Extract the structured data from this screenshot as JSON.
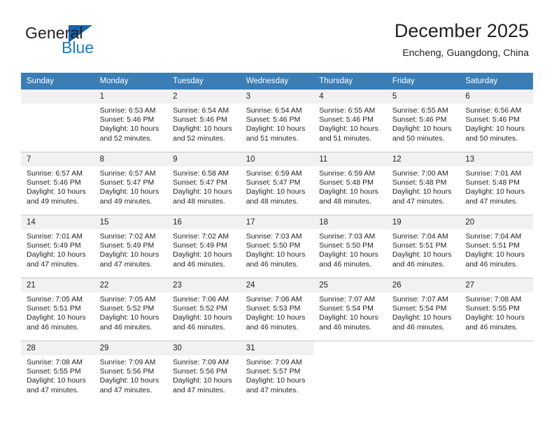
{
  "logo": {
    "word_one": "General",
    "word_two": "Blue",
    "triangle_color": "#1761a8",
    "blue_color": "#1f7ac0"
  },
  "header": {
    "title": "December 2025",
    "subtitle": "Encheng, Guangdong, China"
  },
  "theme": {
    "header_row_bg": "#3b7db5",
    "daynum_bg": "#f1f1f1",
    "grid_line": "#c8c8c8",
    "text": "#231f20"
  },
  "weekday_headers": [
    "Sunday",
    "Monday",
    "Tuesday",
    "Wednesday",
    "Thursday",
    "Friday",
    "Saturday"
  ],
  "weeks": [
    [
      {
        "day": "",
        "sunrise": "",
        "sunset": "",
        "daylight_line1": "",
        "daylight_line2": ""
      },
      {
        "day": "1",
        "sunrise": "Sunrise: 6:53 AM",
        "sunset": "Sunset: 5:46 PM",
        "daylight_line1": "Daylight: 10 hours",
        "daylight_line2": "and 52 minutes."
      },
      {
        "day": "2",
        "sunrise": "Sunrise: 6:54 AM",
        "sunset": "Sunset: 5:46 PM",
        "daylight_line1": "Daylight: 10 hours",
        "daylight_line2": "and 52 minutes."
      },
      {
        "day": "3",
        "sunrise": "Sunrise: 6:54 AM",
        "sunset": "Sunset: 5:46 PM",
        "daylight_line1": "Daylight: 10 hours",
        "daylight_line2": "and 51 minutes."
      },
      {
        "day": "4",
        "sunrise": "Sunrise: 6:55 AM",
        "sunset": "Sunset: 5:46 PM",
        "daylight_line1": "Daylight: 10 hours",
        "daylight_line2": "and 51 minutes."
      },
      {
        "day": "5",
        "sunrise": "Sunrise: 6:55 AM",
        "sunset": "Sunset: 5:46 PM",
        "daylight_line1": "Daylight: 10 hours",
        "daylight_line2": "and 50 minutes."
      },
      {
        "day": "6",
        "sunrise": "Sunrise: 6:56 AM",
        "sunset": "Sunset: 5:46 PM",
        "daylight_line1": "Daylight: 10 hours",
        "daylight_line2": "and 50 minutes."
      }
    ],
    [
      {
        "day": "7",
        "sunrise": "Sunrise: 6:57 AM",
        "sunset": "Sunset: 5:46 PM",
        "daylight_line1": "Daylight: 10 hours",
        "daylight_line2": "and 49 minutes."
      },
      {
        "day": "8",
        "sunrise": "Sunrise: 6:57 AM",
        "sunset": "Sunset: 5:47 PM",
        "daylight_line1": "Daylight: 10 hours",
        "daylight_line2": "and 49 minutes."
      },
      {
        "day": "9",
        "sunrise": "Sunrise: 6:58 AM",
        "sunset": "Sunset: 5:47 PM",
        "daylight_line1": "Daylight: 10 hours",
        "daylight_line2": "and 48 minutes."
      },
      {
        "day": "10",
        "sunrise": "Sunrise: 6:59 AM",
        "sunset": "Sunset: 5:47 PM",
        "daylight_line1": "Daylight: 10 hours",
        "daylight_line2": "and 48 minutes."
      },
      {
        "day": "11",
        "sunrise": "Sunrise: 6:59 AM",
        "sunset": "Sunset: 5:48 PM",
        "daylight_line1": "Daylight: 10 hours",
        "daylight_line2": "and 48 minutes."
      },
      {
        "day": "12",
        "sunrise": "Sunrise: 7:00 AM",
        "sunset": "Sunset: 5:48 PM",
        "daylight_line1": "Daylight: 10 hours",
        "daylight_line2": "and 47 minutes."
      },
      {
        "day": "13",
        "sunrise": "Sunrise: 7:01 AM",
        "sunset": "Sunset: 5:48 PM",
        "daylight_line1": "Daylight: 10 hours",
        "daylight_line2": "and 47 minutes."
      }
    ],
    [
      {
        "day": "14",
        "sunrise": "Sunrise: 7:01 AM",
        "sunset": "Sunset: 5:49 PM",
        "daylight_line1": "Daylight: 10 hours",
        "daylight_line2": "and 47 minutes."
      },
      {
        "day": "15",
        "sunrise": "Sunrise: 7:02 AM",
        "sunset": "Sunset: 5:49 PM",
        "daylight_line1": "Daylight: 10 hours",
        "daylight_line2": "and 47 minutes."
      },
      {
        "day": "16",
        "sunrise": "Sunrise: 7:02 AM",
        "sunset": "Sunset: 5:49 PM",
        "daylight_line1": "Daylight: 10 hours",
        "daylight_line2": "and 46 minutes."
      },
      {
        "day": "17",
        "sunrise": "Sunrise: 7:03 AM",
        "sunset": "Sunset: 5:50 PM",
        "daylight_line1": "Daylight: 10 hours",
        "daylight_line2": "and 46 minutes."
      },
      {
        "day": "18",
        "sunrise": "Sunrise: 7:03 AM",
        "sunset": "Sunset: 5:50 PM",
        "daylight_line1": "Daylight: 10 hours",
        "daylight_line2": "and 46 minutes."
      },
      {
        "day": "19",
        "sunrise": "Sunrise: 7:04 AM",
        "sunset": "Sunset: 5:51 PM",
        "daylight_line1": "Daylight: 10 hours",
        "daylight_line2": "and 46 minutes."
      },
      {
        "day": "20",
        "sunrise": "Sunrise: 7:04 AM",
        "sunset": "Sunset: 5:51 PM",
        "daylight_line1": "Daylight: 10 hours",
        "daylight_line2": "and 46 minutes."
      }
    ],
    [
      {
        "day": "21",
        "sunrise": "Sunrise: 7:05 AM",
        "sunset": "Sunset: 5:51 PM",
        "daylight_line1": "Daylight: 10 hours",
        "daylight_line2": "and 46 minutes."
      },
      {
        "day": "22",
        "sunrise": "Sunrise: 7:05 AM",
        "sunset": "Sunset: 5:52 PM",
        "daylight_line1": "Daylight: 10 hours",
        "daylight_line2": "and 46 minutes."
      },
      {
        "day": "23",
        "sunrise": "Sunrise: 7:06 AM",
        "sunset": "Sunset: 5:52 PM",
        "daylight_line1": "Daylight: 10 hours",
        "daylight_line2": "and 46 minutes."
      },
      {
        "day": "24",
        "sunrise": "Sunrise: 7:06 AM",
        "sunset": "Sunset: 5:53 PM",
        "daylight_line1": "Daylight: 10 hours",
        "daylight_line2": "and 46 minutes."
      },
      {
        "day": "25",
        "sunrise": "Sunrise: 7:07 AM",
        "sunset": "Sunset: 5:54 PM",
        "daylight_line1": "Daylight: 10 hours",
        "daylight_line2": "and 46 minutes."
      },
      {
        "day": "26",
        "sunrise": "Sunrise: 7:07 AM",
        "sunset": "Sunset: 5:54 PM",
        "daylight_line1": "Daylight: 10 hours",
        "daylight_line2": "and 46 minutes."
      },
      {
        "day": "27",
        "sunrise": "Sunrise: 7:08 AM",
        "sunset": "Sunset: 5:55 PM",
        "daylight_line1": "Daylight: 10 hours",
        "daylight_line2": "and 46 minutes."
      }
    ],
    [
      {
        "day": "28",
        "sunrise": "Sunrise: 7:08 AM",
        "sunset": "Sunset: 5:55 PM",
        "daylight_line1": "Daylight: 10 hours",
        "daylight_line2": "and 47 minutes."
      },
      {
        "day": "29",
        "sunrise": "Sunrise: 7:09 AM",
        "sunset": "Sunset: 5:56 PM",
        "daylight_line1": "Daylight: 10 hours",
        "daylight_line2": "and 47 minutes."
      },
      {
        "day": "30",
        "sunrise": "Sunrise: 7:09 AM",
        "sunset": "Sunset: 5:56 PM",
        "daylight_line1": "Daylight: 10 hours",
        "daylight_line2": "and 47 minutes."
      },
      {
        "day": "31",
        "sunrise": "Sunrise: 7:09 AM",
        "sunset": "Sunset: 5:57 PM",
        "daylight_line1": "Daylight: 10 hours",
        "daylight_line2": "and 47 minutes."
      },
      {
        "day": "",
        "sunrise": "",
        "sunset": "",
        "daylight_line1": "",
        "daylight_line2": ""
      },
      {
        "day": "",
        "sunrise": "",
        "sunset": "",
        "daylight_line1": "",
        "daylight_line2": ""
      },
      {
        "day": "",
        "sunrise": "",
        "sunset": "",
        "daylight_line1": "",
        "daylight_line2": ""
      }
    ]
  ]
}
